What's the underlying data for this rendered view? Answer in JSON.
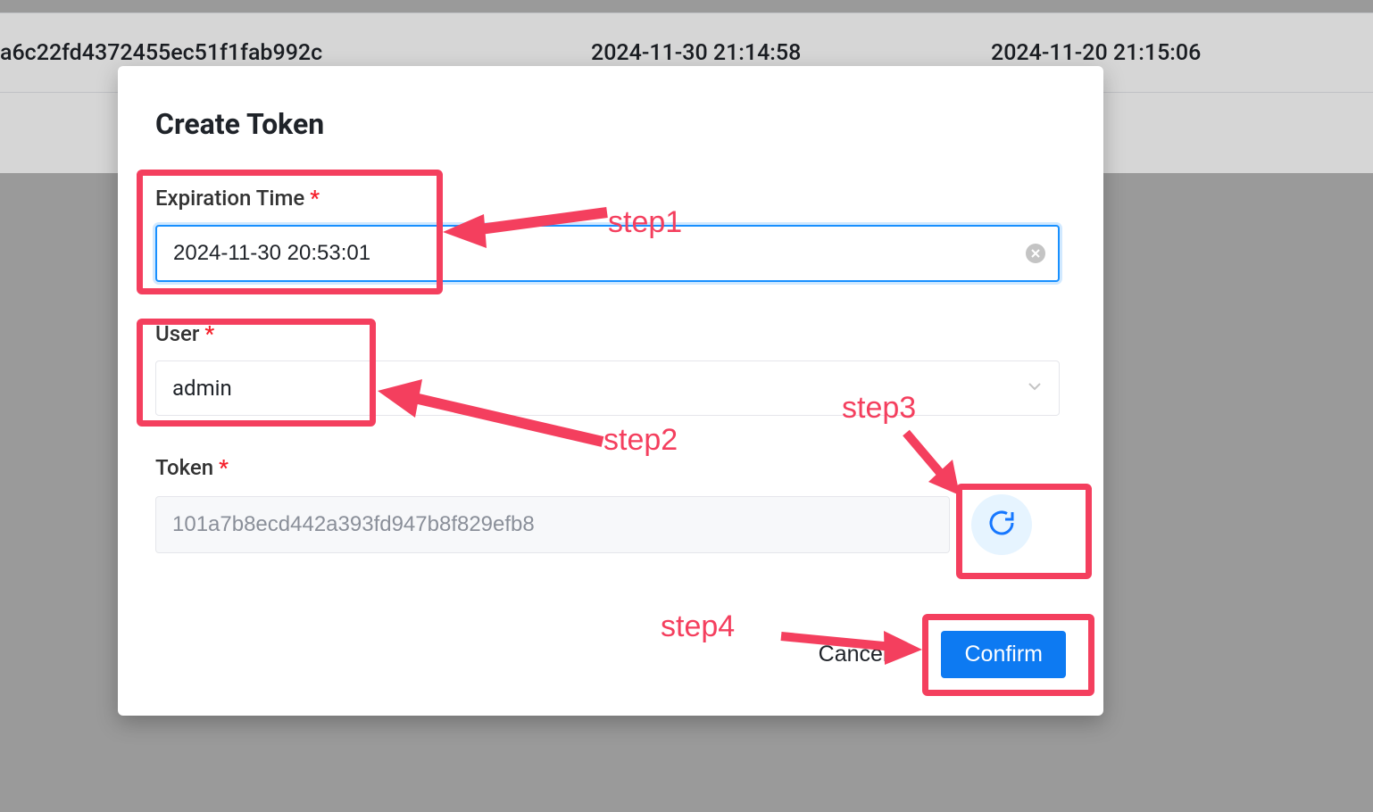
{
  "background": {
    "col1": "a6c22fd4372455ec51f1fab992c",
    "col2": "2024-11-30 21:14:58",
    "col3": "2024-11-20 21:15:06"
  },
  "modal": {
    "title": "Create Token",
    "expiration": {
      "label": "Expiration Time",
      "value": "2024-11-30 20:53:01"
    },
    "user": {
      "label": "User",
      "value": "admin"
    },
    "token": {
      "label": "Token",
      "value": "101a7b8ecd442a393fd947b8f829efb8"
    },
    "actions": {
      "cancel": "Cancel",
      "confirm": "Confirm"
    }
  },
  "annotations": {
    "step1": "step1",
    "step2": "step2",
    "step3": "step3",
    "step4": "step4"
  }
}
